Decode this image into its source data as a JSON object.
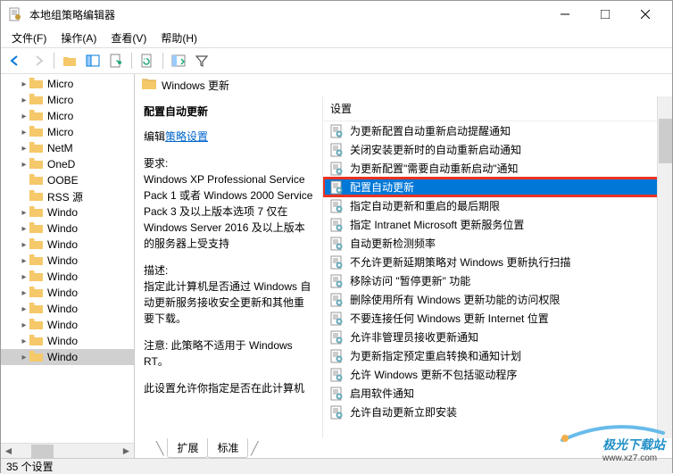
{
  "window": {
    "title": "本地组策略编辑器"
  },
  "menus": [
    "文件(F)",
    "操作(A)",
    "查看(V)",
    "帮助(H)"
  ],
  "tree": {
    "items": [
      {
        "label": "Micro",
        "expandable": true
      },
      {
        "label": "Micro",
        "expandable": true
      },
      {
        "label": "Micro",
        "expandable": true
      },
      {
        "label": "Micro",
        "expandable": true
      },
      {
        "label": "NetM",
        "expandable": true
      },
      {
        "label": "OneD",
        "expandable": true
      },
      {
        "label": "OOBE",
        "expandable": false
      },
      {
        "label": "RSS 源",
        "expandable": false
      },
      {
        "label": "Windo",
        "expandable": true
      },
      {
        "label": "Windo",
        "expandable": true
      },
      {
        "label": "Windo",
        "expandable": true
      },
      {
        "label": "Windo",
        "expandable": true
      },
      {
        "label": "Windo",
        "expandable": true
      },
      {
        "label": "Windo",
        "expandable": true
      },
      {
        "label": "Windo",
        "expandable": true
      },
      {
        "label": "Windo",
        "expandable": true
      },
      {
        "label": "Windo",
        "expandable": true
      },
      {
        "label": "Windo",
        "expandable": true,
        "selected": true
      }
    ]
  },
  "header": {
    "title": "Windows 更新"
  },
  "description": {
    "title": "配置自动更新",
    "edit_link_prefix": "编辑",
    "edit_link": "策略设置",
    "req_label": "要求:",
    "req_text": "Windows XP Professional Service Pack 1 或者 Windows 2000 Service Pack 3 及以上版本选项 7 仅在 Windows Server 2016 及以上版本的服务器上受支持",
    "desc_label": "描述:",
    "desc_text": "指定此计算机是否通过 Windows 自动更新服务接收安全更新和其他重要下载。",
    "note_text": "注意: 此策略不适用于 Windows RT。",
    "more_text": "此设置允许你指定是否在此计算机"
  },
  "settings": {
    "column_header": "设置",
    "items": [
      "为更新配置自动重新启动提醒通知",
      "关闭安装更新时的自动重新启动通知",
      "为更新配置\"需要自动重新启动\"通知",
      "配置自动更新",
      "指定自动更新和重启的最后期限",
      "指定 Intranet Microsoft 更新服务位置",
      "自动更新检测频率",
      "不允许更新延期策略对 Windows 更新执行扫描",
      "移除访问 \"暂停更新\" 功能",
      "删除使用所有 Windows 更新功能的访问权限",
      "不要连接任何 Windows 更新 Internet 位置",
      "允许非管理员接收更新通知",
      "为更新指定预定重启转换和通知计划",
      "允许 Windows 更新不包括驱动程序",
      "启用软件通知",
      "允许自动更新立即安装"
    ],
    "selected_index": 3
  },
  "tabs": {
    "items": [
      "扩展",
      "标准"
    ],
    "active": 0
  },
  "statusbar": {
    "text": "35 个设置"
  },
  "watermark": {
    "brand": "极光下载站",
    "url": "www.xz7.com"
  }
}
